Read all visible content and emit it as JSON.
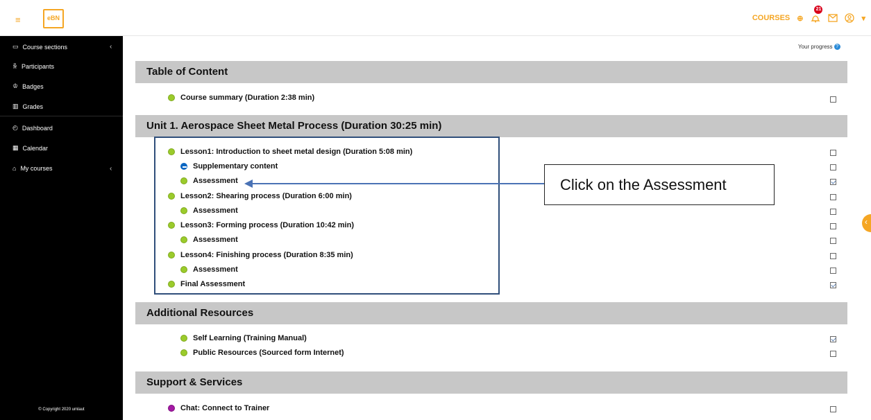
{
  "header": {
    "menu_icon": "hamburger-icon",
    "logo_text": "eBN",
    "courses_label": "COURSES",
    "notification_count": "21"
  },
  "sidebar": {
    "items": [
      {
        "label": "Course sections",
        "icon": "folder-icon",
        "chevron": "‹"
      },
      {
        "label": "Participants",
        "icon": "people-icon"
      },
      {
        "label": "Badges",
        "icon": "badge-icon"
      },
      {
        "label": "Grades",
        "icon": "grades-icon"
      },
      {
        "label": "Dashboard",
        "icon": "dashboard-icon"
      },
      {
        "label": "Calendar",
        "icon": "calendar-icon"
      },
      {
        "label": "My courses",
        "icon": "graduation-cap-icon",
        "chevron": "‹"
      }
    ],
    "copyright": "© Copyright 2020 umlaut"
  },
  "main": {
    "progress_label": "Your progress",
    "sections": [
      {
        "title": "Table of Content",
        "items": [
          {
            "label": "Course summary (Duration 2:38 min)",
            "status": "green",
            "checked": false
          }
        ]
      },
      {
        "title": "Unit 1. Aerospace Sheet Metal Process (Duration 30:25 min)",
        "items": [
          {
            "label": "Lesson1: Introduction to sheet metal design (Duration 5:08 min)",
            "status": "green",
            "checked": false
          },
          {
            "label": "Supplementary content",
            "status": "blue",
            "checked": false
          },
          {
            "label": "Assessment",
            "status": "green",
            "checked": true
          },
          {
            "label": "Lesson2: Shearing process (Duration 6:00 min)",
            "status": "green",
            "checked": false
          },
          {
            "label": "Assessment",
            "status": "green",
            "checked": false
          },
          {
            "label": "Lesson3: Forming process (Duration 10:42 min)",
            "status": "green",
            "checked": false
          },
          {
            "label": "Assessment",
            "status": "green",
            "checked": false
          },
          {
            "label": "Lesson4: Finishing process (Duration 8:35 min)",
            "status": "green",
            "checked": false
          },
          {
            "label": "Assessment",
            "status": "green",
            "checked": false
          },
          {
            "label": "Final Assessment",
            "status": "green",
            "checked": true
          }
        ]
      },
      {
        "title": "Additional Resources",
        "items": [
          {
            "label": "Self Learning (Training Manual)",
            "status": "green",
            "checked": true
          },
          {
            "label": "Public Resources (Sourced form Internet)",
            "status": "green",
            "checked": false
          }
        ]
      },
      {
        "title": "Support & Services",
        "items": [
          {
            "label": "Chat: Connect to Trainer",
            "status": "purple",
            "checked": false
          }
        ]
      }
    ]
  },
  "annotation": {
    "callout_text": "Click on the Assessment"
  },
  "colors": {
    "accent": "#f5a623",
    "sidebar_bg": "#000000",
    "section_bg": "#c7c7c7",
    "status_green": "#9bcb2b",
    "status_blue": "#0b66c2",
    "status_purple": "#a41aa4",
    "frame_border": "#2f4e7a",
    "arrow": "#4a72b5"
  }
}
